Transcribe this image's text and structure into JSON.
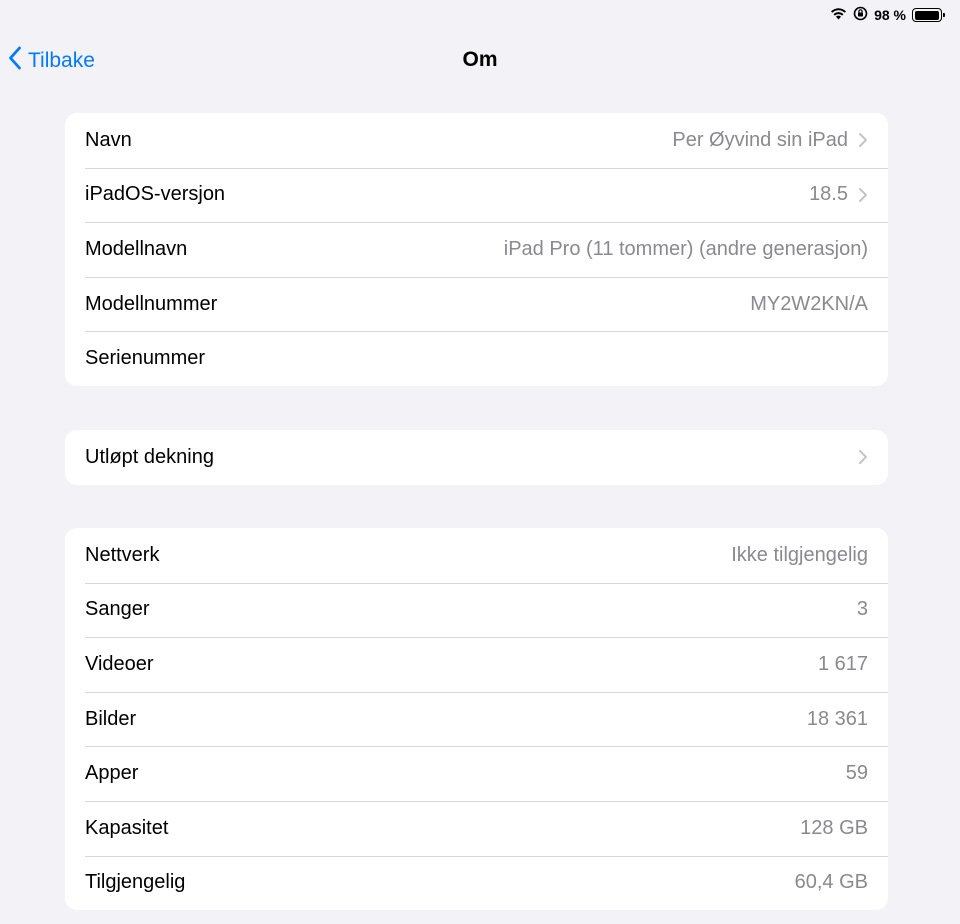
{
  "status_bar": {
    "battery_percent": "98 %",
    "battery_level": 0.98,
    "icons": [
      "wifi-icon",
      "orientation-lock-icon",
      "battery-icon"
    ]
  },
  "nav": {
    "back_label": "Tilbake",
    "title": "Om"
  },
  "group1": {
    "rows": [
      {
        "label": "Navn",
        "value": "Per Øyvind sin iPad",
        "chevron": true
      },
      {
        "label": "iPadOS-versjon",
        "value": "18.5",
        "chevron": true
      },
      {
        "label": "Modellnavn",
        "value": "iPad Pro (11 tommer) (andre generasjon)",
        "chevron": false
      },
      {
        "label": "Modellnummer",
        "value": "MY2W2KN/A",
        "chevron": false
      },
      {
        "label": "Serienummer",
        "value": "",
        "chevron": false
      }
    ]
  },
  "group2": {
    "rows": [
      {
        "label": "Utløpt dekning",
        "chevron": true
      }
    ]
  },
  "group3": {
    "rows": [
      {
        "label": "Nettverk",
        "value": "Ikke tilgjengelig"
      },
      {
        "label": "Sanger",
        "value": "3"
      },
      {
        "label": "Videoer",
        "value": "1 617"
      },
      {
        "label": "Bilder",
        "value": "18 361"
      },
      {
        "label": "Apper",
        "value": "59"
      },
      {
        "label": "Kapasitet",
        "value": "128 GB"
      },
      {
        "label": "Tilgjengelig",
        "value": "60,4 GB"
      }
    ]
  },
  "colors": {
    "accent": "#007aff",
    "background": "#f2f2f7",
    "secondary_text": "#8a8a8e"
  }
}
